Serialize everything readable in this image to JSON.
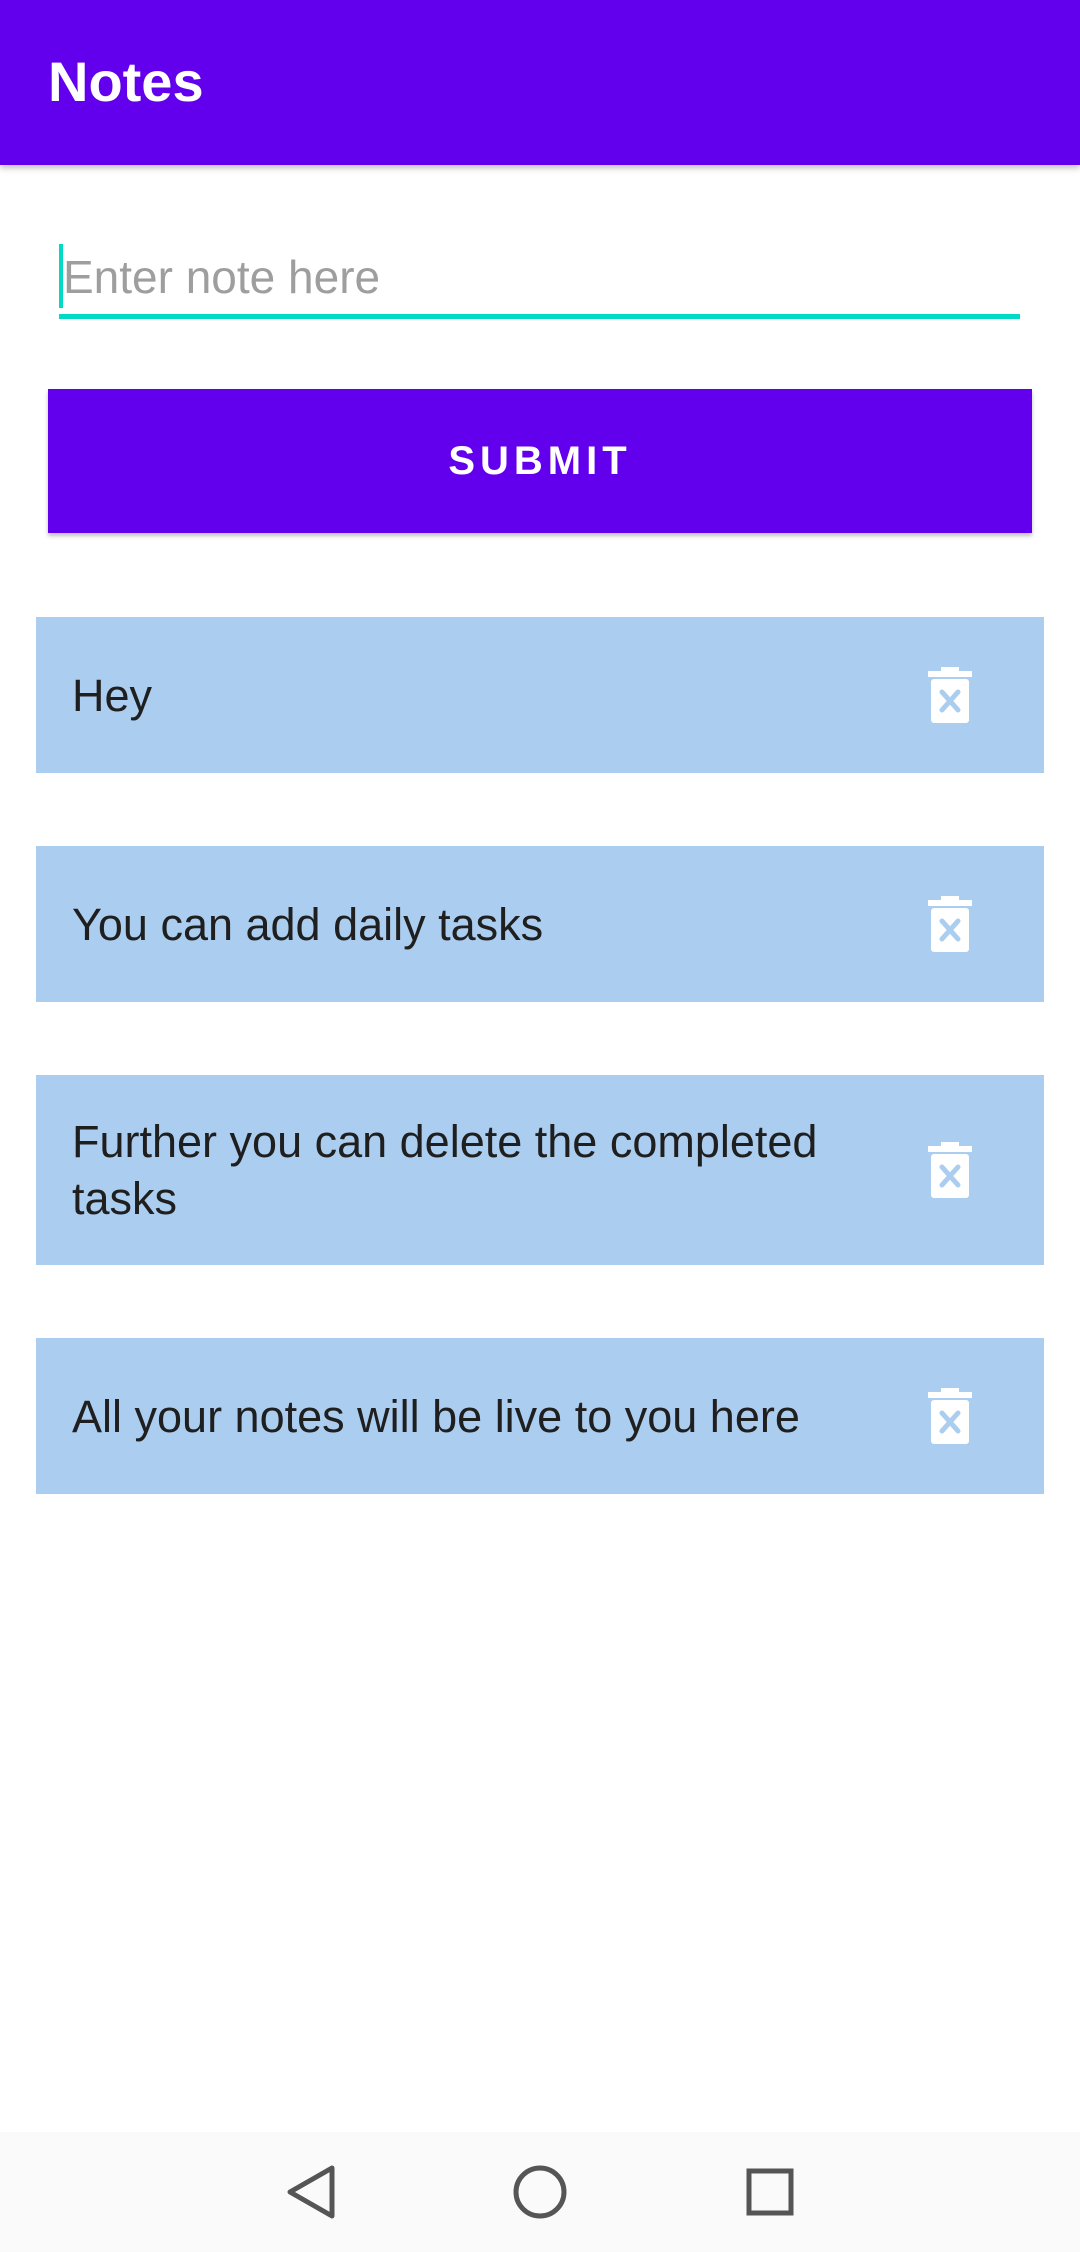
{
  "app_bar": {
    "title": "Notes"
  },
  "note_input": {
    "placeholder": "Enter note here",
    "value": ""
  },
  "submit_button": {
    "label": "SUBMIT"
  },
  "notes": [
    {
      "text": "Hey",
      "delete_icon": "trash-icon"
    },
    {
      "text": "You can add daily tasks",
      "delete_icon": "trash-icon"
    },
    {
      "text": "Further you can delete the completed tasks",
      "delete_icon": "trash-icon"
    },
    {
      "text": "All your notes will be live to you here",
      "delete_icon": "trash-icon"
    }
  ],
  "nav_bar": {
    "back_icon": "back-icon",
    "home_icon": "home-icon",
    "recents_icon": "recents-icon"
  },
  "colors": {
    "primary": "#6200ee",
    "accent": "#03dac5",
    "card_background": "#abcdef",
    "on_primary": "#ffffff"
  }
}
